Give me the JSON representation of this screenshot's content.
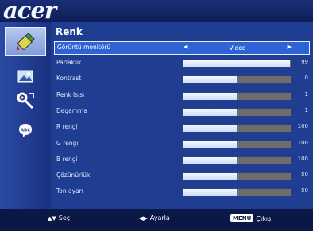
{
  "brand": {
    "logo": "acer"
  },
  "sidebar": {
    "items": [
      {
        "icon": "color-icon",
        "selected": true
      },
      {
        "icon": "image-icon",
        "selected": false
      },
      {
        "icon": "settings-icon",
        "selected": false
      },
      {
        "icon": "language-icon",
        "selected": false
      }
    ]
  },
  "menu": {
    "title": "Renk",
    "display_mode": {
      "label": "Görüntü monitörü",
      "value": "Video"
    },
    "rows": [
      {
        "label": "Parlaklık",
        "value": "99",
        "level": 0.99
      },
      {
        "label": "Kontrast",
        "value": "0",
        "level": 0.5
      },
      {
        "label": "Renk Isısı",
        "value": "1",
        "level": 0.5
      },
      {
        "label": "Degamma",
        "value": "1",
        "level": 0.5
      },
      {
        "label": "R rengi",
        "value": "100",
        "level": 0.5
      },
      {
        "label": "G rengi",
        "value": "100",
        "level": 0.5
      },
      {
        "label": "B rengi",
        "value": "100",
        "level": 0.5
      },
      {
        "label": "Çözünürlük",
        "value": "50",
        "level": 0.5
      },
      {
        "label": "Ton ayarı",
        "value": "50",
        "level": 0.5
      }
    ]
  },
  "footer": {
    "select_label": "Seç",
    "adjust_label": "Ayarla",
    "menu_key": "MENU",
    "exit_label": "Çıkış"
  },
  "colors": {
    "panel": "#1f3d91",
    "highlight": "#2d63d4",
    "sidebar": "#2a4aa4"
  }
}
